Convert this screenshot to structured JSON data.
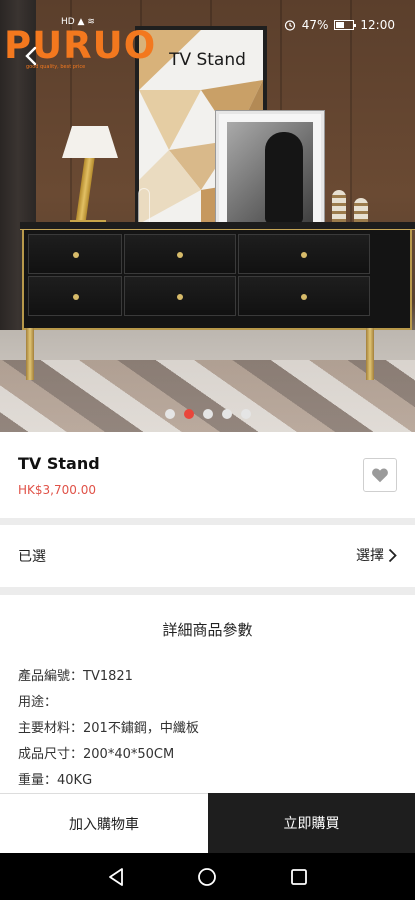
{
  "status_bar": {
    "carrier_icons": "HD ▲ ≋",
    "battery_percent": "47%",
    "time": "12:00"
  },
  "header": {
    "brand_logo": "PURUO",
    "brand_tagline": "good quality, best price",
    "title": "TV Stand",
    "back_icon": "chevron-left-icon"
  },
  "carousel": {
    "dot_count": 5,
    "active_index": 1
  },
  "product": {
    "name": "TV Stand",
    "price": "HK$3,700.00",
    "favorite_icon": "heart-icon"
  },
  "options": {
    "label": "已選",
    "action": "選擇"
  },
  "details": {
    "title": "詳細商品參數",
    "specs": [
      "產品編號：TV1821",
      "用途：",
      "主要材料：201不鏽鋼，中纖板",
      "成品尺寸：200*40*50CM",
      "重量：40KG"
    ]
  },
  "actions": {
    "add_to_cart": "加入購物車",
    "buy_now": "立即購買"
  },
  "colors": {
    "price_red": "#e05248",
    "brand_orange": "#f3781e",
    "buy_button_bg": "#1e1e1e",
    "active_dot": "#e9463b"
  }
}
